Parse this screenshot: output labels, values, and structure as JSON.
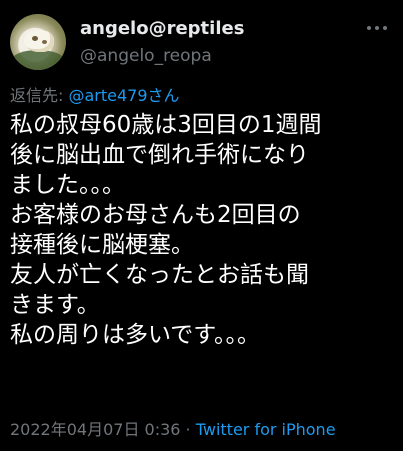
{
  "author": {
    "display_name": "angelo@reptiles",
    "handle": "@angelo_reopa"
  },
  "reply": {
    "prefix": "返信先: ",
    "mention": "@arte479さん"
  },
  "tweet": {
    "lines": [
      "私の叔母60歳は3回目の1週間",
      "後に脳出血で倒れ手術になり",
      "ました。。。",
      "お客様のお母さんも2回目の",
      "接種後に脳梗塞。",
      "友人が亡くなったとお話も聞",
      "きます。",
      "私の周りは多いです。。。"
    ]
  },
  "meta": {
    "timestamp": "2022年04月07日 0:36",
    "separator": " · ",
    "source": "Twitter for iPhone"
  },
  "colors": {
    "background": "#000000",
    "text": "#ffffff",
    "secondary": "#71767b",
    "link": "#1d9bf0"
  }
}
